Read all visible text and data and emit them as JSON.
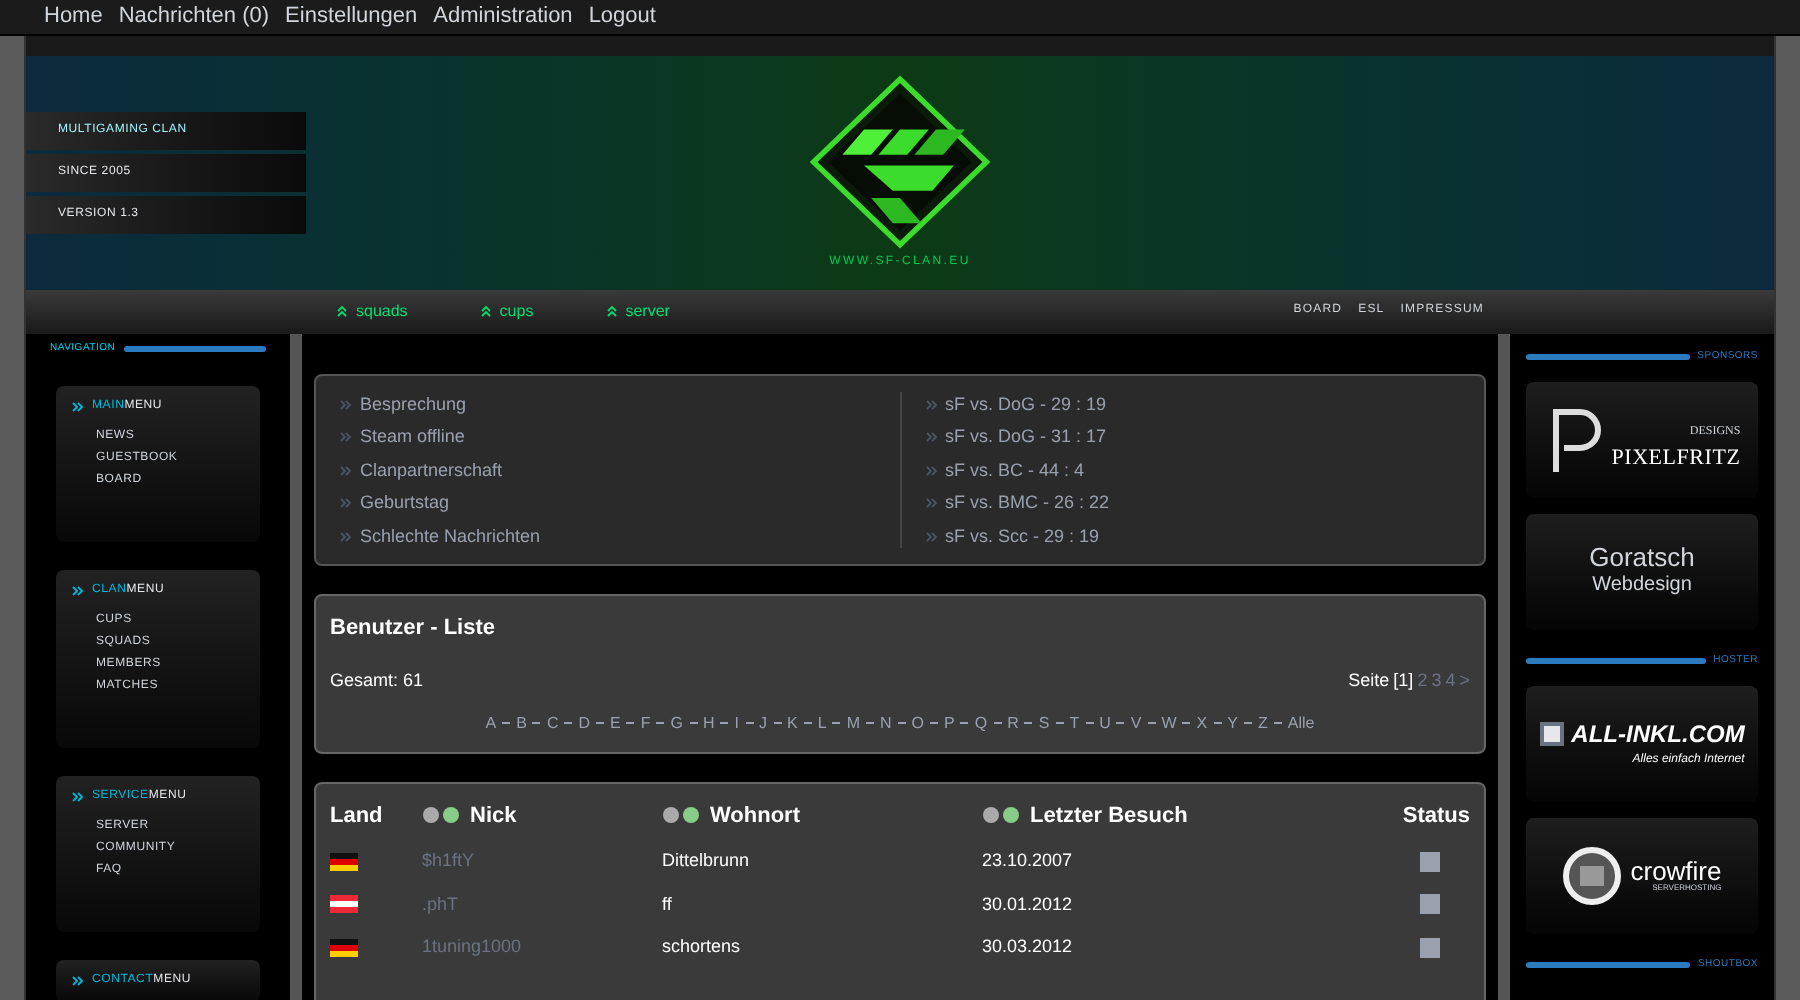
{
  "top_nav": [
    "Home",
    "Nachrichten (0)",
    "Einstellungen",
    "Administration",
    "Logout"
  ],
  "banner": {
    "tags": [
      "MULTIGAMING CLAN",
      "SINCE 2005",
      "VERSION 1.3"
    ],
    "url": "WWW.SF-CLAN.EU"
  },
  "sub_nav": {
    "left": [
      "squads",
      "cups",
      "server"
    ],
    "right": [
      "BOARD",
      "ESL",
      "IMPRESSUM"
    ]
  },
  "sidebar": {
    "title": "NAVIGATION",
    "menus": [
      {
        "highlight": "MAIN",
        "rest": "MENU",
        "items": [
          "NEWS",
          "GUESTBOOK",
          "BOARD"
        ]
      },
      {
        "highlight": "CLAN",
        "rest": "MENU",
        "items": [
          "CUPS",
          "SQUADS",
          "MEMBERS",
          "MATCHES"
        ]
      },
      {
        "highlight": "SERVICE",
        "rest": "MENU",
        "items": [
          "SERVER",
          "COMMUNITY",
          "FAQ"
        ]
      },
      {
        "highlight": "CONTACT",
        "rest": "MENU"
      }
    ]
  },
  "news": [
    "Besprechung",
    "Steam offline",
    "Clanpartnerschaft",
    "Geburtstag",
    "Schlechte Nachrichten"
  ],
  "matches": [
    "sF vs. DoG - 29 : 19",
    "sF vs. DoG - 31 : 17",
    "sF vs. BC - 44 : 4",
    "sF vs. BMC - 26 : 22",
    "sF vs. Scc - 29 : 19"
  ],
  "user_list": {
    "title": "Benutzer - Liste",
    "total": "Gesamt: 61",
    "page_label": "Seite",
    "pages": [
      {
        "label": "[1]",
        "selected": true
      },
      {
        "label": "2",
        "selected": false
      },
      {
        "label": "3",
        "selected": false
      },
      {
        "label": "4",
        "selected": false
      }
    ],
    "next": ">",
    "letters": [
      "A",
      "B",
      "C",
      "D",
      "E",
      "F",
      "G",
      "H",
      "I",
      "J",
      "K",
      "L",
      "M",
      "N",
      "O",
      "P",
      "Q",
      "R",
      "S",
      "T",
      "U",
      "V",
      "W",
      "X",
      "Y",
      "Z",
      "Alle"
    ]
  },
  "table": {
    "columns": [
      "Land",
      "Nick",
      "Wohnort",
      "Letzter Besuch",
      "Status"
    ],
    "rows": [
      {
        "kind": "de",
        "nick": "$h1ftY",
        "wohnort": "Dittelbrunn",
        "besuch": "23.10.2007",
        "online": false
      },
      {
        "kind": "at",
        "nick": ".phT",
        "wohnort": "ff",
        "besuch": "30.01.2012",
        "online": false
      },
      {
        "kind": "de",
        "nick": "1tuning1000",
        "wohnort": "schortens",
        "besuch": "30.03.2012",
        "online": false
      }
    ]
  },
  "right_sidebar": {
    "sections": [
      {
        "title": "SPONSORS",
        "sponsors": [
          {
            "kind": "pixelfritz",
            "name": "PIXELFRITZ",
            "sub": "DESIGNS"
          },
          {
            "kind": "goratsch",
            "name": "Goratsch",
            "sub": "Webdesign"
          }
        ]
      },
      {
        "title": "HOSTER",
        "sponsors": [
          {
            "kind": "allinkl",
            "name": "ALL-INKL.COM",
            "sub": "Alles einfach Internet"
          },
          {
            "kind": "crowfire",
            "name": "crowfire",
            "sub": "SERVERHOSTING"
          }
        ]
      },
      {
        "title": "SHOUTBOX"
      }
    ]
  }
}
